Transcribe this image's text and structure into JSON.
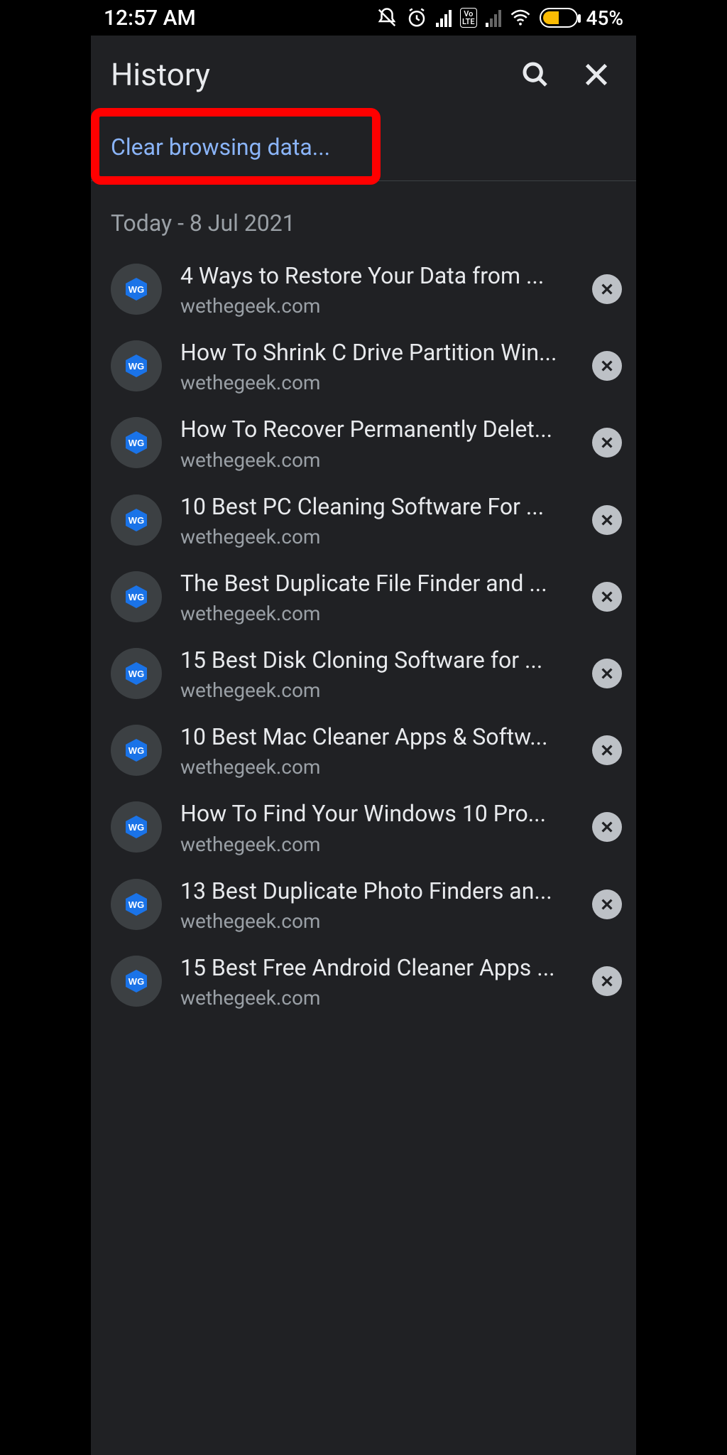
{
  "statusbar": {
    "time": "12:57 AM",
    "battery_pct": "45%"
  },
  "header": {
    "title": "History"
  },
  "clear_data": {
    "label": "Clear browsing data..."
  },
  "date_header": "Today - 8 Jul 2021",
  "history": [
    {
      "title": "4 Ways to Restore Your Data from ...",
      "domain": "wethegeek.com"
    },
    {
      "title": "How To Shrink C Drive Partition Win...",
      "domain": "wethegeek.com"
    },
    {
      "title": "How To Recover Permanently Delet...",
      "domain": "wethegeek.com"
    },
    {
      "title": "10 Best PC Cleaning Software For ...",
      "domain": "wethegeek.com"
    },
    {
      "title": "The Best Duplicate File Finder and ...",
      "domain": "wethegeek.com"
    },
    {
      "title": "15 Best Disk Cloning Software for ...",
      "domain": "wethegeek.com"
    },
    {
      "title": "10 Best Mac Cleaner Apps & Softw...",
      "domain": "wethegeek.com"
    },
    {
      "title": "How To Find Your Windows 10 Pro...",
      "domain": "wethegeek.com"
    },
    {
      "title": "13 Best Duplicate Photo Finders an...",
      "domain": "wethegeek.com"
    },
    {
      "title": "15 Best Free Android Cleaner Apps ...",
      "domain": "wethegeek.com"
    }
  ],
  "annotation": {
    "highlight_color": "#ff0000"
  }
}
